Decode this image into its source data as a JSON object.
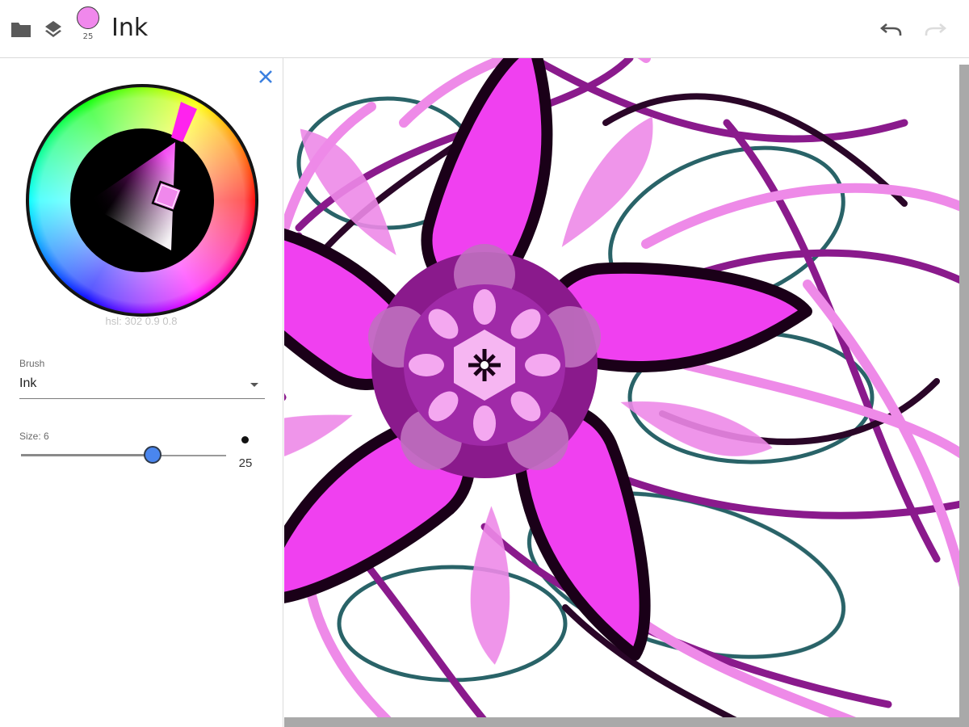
{
  "toolbar": {
    "title": "Ink",
    "brush_size_badge": "25",
    "current_color": "#f088ec",
    "icons": [
      "folder-icon",
      "layers-icon",
      "undo-icon",
      "redo-icon"
    ]
  },
  "panel": {
    "close_icon": "close-icon",
    "hsl_readout": "hsl: 302 0.9 0.8",
    "brush": {
      "label": "Brush",
      "value": "Ink"
    },
    "size": {
      "label": "Size: 6",
      "value_fraction": 0.64,
      "max_display": "25"
    }
  },
  "colors": {
    "accent": "#4a86ee",
    "close": "#3b7fe0",
    "magenta": "#f040f0",
    "pink": "#ee8ae8",
    "purple": "#8a1a8c",
    "dark_purple": "#2a0628",
    "teal": "#1e5b60"
  }
}
